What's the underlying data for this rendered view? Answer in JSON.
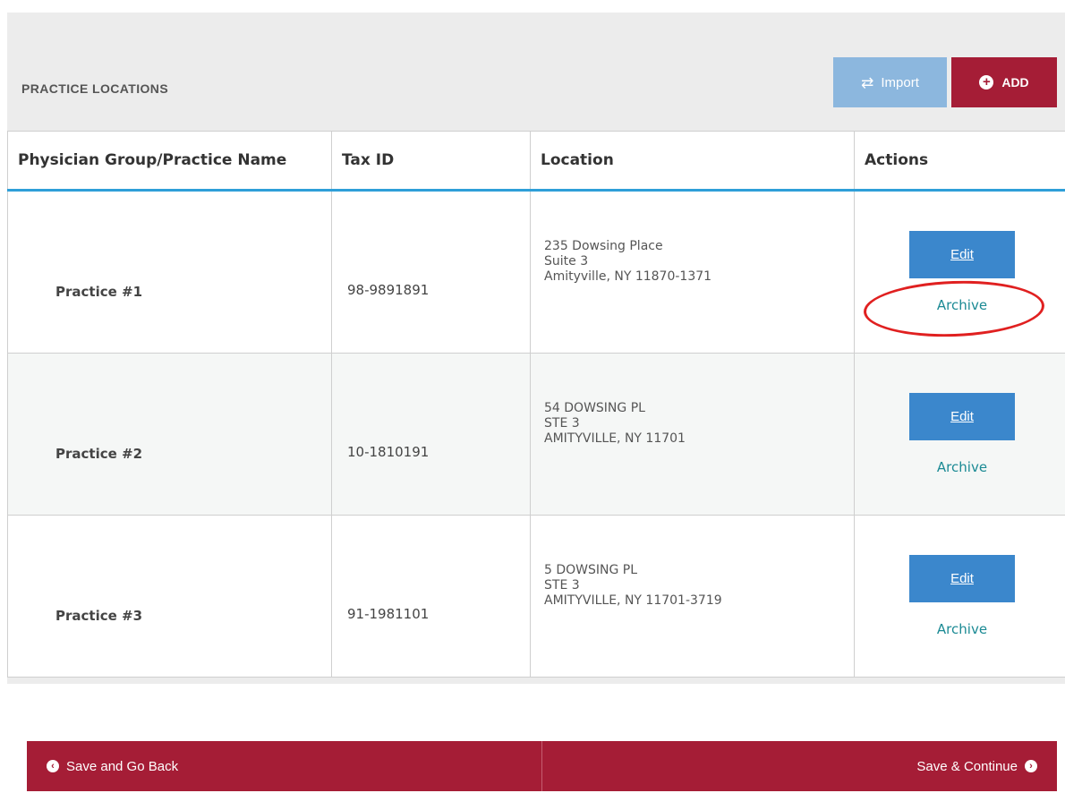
{
  "panel": {
    "title": "PRACTICE LOCATIONS",
    "import_label": "Import",
    "add_label": "ADD"
  },
  "table": {
    "columns": [
      "Physician Group/Practice Name",
      "Tax ID",
      "Location",
      "Actions"
    ],
    "rows": [
      {
        "name": "Practice #1",
        "tax_id": "98-9891891",
        "location": [
          "235 Dowsing Place",
          "Suite 3",
          "Amityville, NY 11870-1371"
        ],
        "edit_label": "Edit",
        "archive_label": "Archive"
      },
      {
        "name": "Practice #2",
        "tax_id": "10-1810191",
        "location": [
          "54 DOWSING PL",
          "STE 3",
          "AMITYVILLE, NY 11701"
        ],
        "edit_label": "Edit",
        "archive_label": "Archive"
      },
      {
        "name": "Practice #3",
        "tax_id": "91-1981101",
        "location": [
          "5 DOWSING PL",
          "STE 3",
          "AMITYVILLE, NY 11701-3719"
        ],
        "edit_label": "Edit",
        "archive_label": "Archive"
      }
    ]
  },
  "footer": {
    "back_label": "Save and Go Back",
    "continue_label": "Save & Continue"
  },
  "colors": {
    "brand_red": "#a51d36",
    "edit_blue": "#3b87cc",
    "import_blue": "#8cb7de",
    "header_rule": "#2e9fd8",
    "archive_teal": "#1b8a94",
    "annotation_red": "#e02020"
  },
  "icons": {
    "import": "swap-arrows-icon",
    "add": "plus-circle-icon",
    "back": "chevron-left-circle-icon",
    "continue": "chevron-right-circle-icon"
  }
}
